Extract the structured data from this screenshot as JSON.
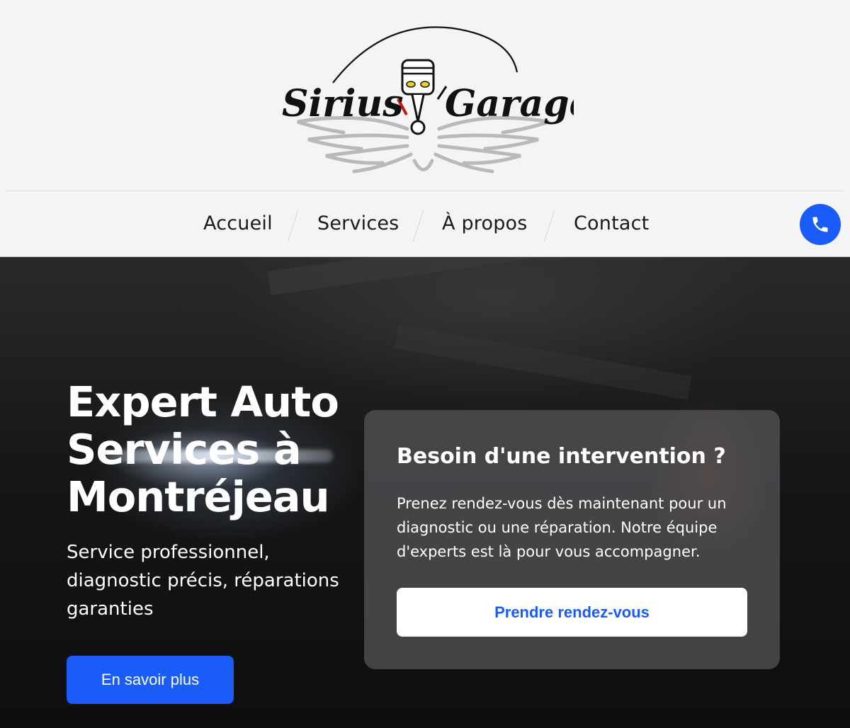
{
  "brand": {
    "logo_text_left": "Sirius",
    "logo_text_right": "Garage"
  },
  "nav": {
    "items": [
      {
        "label": "Accueil"
      },
      {
        "label": "Services"
      },
      {
        "label": "À propos"
      },
      {
        "label": "Contact"
      }
    ],
    "phone_icon": "phone-icon"
  },
  "hero": {
    "title": "Expert Auto Services à Montréjeau",
    "subtitle": "Service professionnel, diagnostic précis, réparations garanties",
    "cta_label": "En savoir plus"
  },
  "card": {
    "title": "Besoin d'une intervention ?",
    "text": "Prenez rendez-vous dès maintenant pour un diagnostic ou une réparation. Notre équipe d'experts est là pour vous accompagner.",
    "button_label": "Prendre rendez-vous"
  },
  "colors": {
    "accent": "#1a5cf7",
    "header_bg": "#f4f4f6",
    "hero_bg": "#161616"
  }
}
